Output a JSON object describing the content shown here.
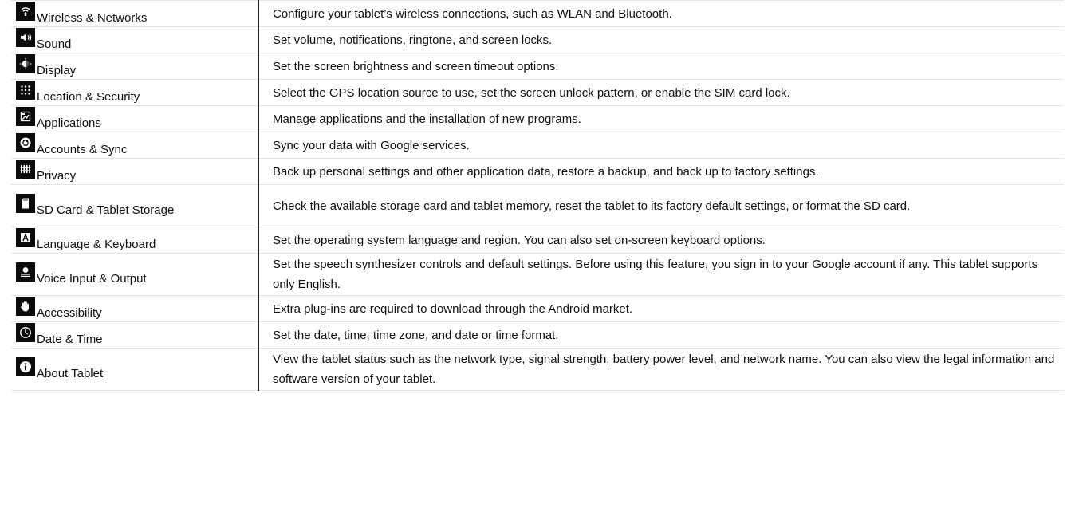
{
  "rows": [
    {
      "icon": "wifi-icon",
      "name": "Wireless & Networks",
      "desc": "Configure your tablet’s wireless connections, such as WLAN and Bluetooth."
    },
    {
      "icon": "speaker-icon",
      "name": "Sound",
      "desc": "Set volume, notifications, ringtone, and screen locks."
    },
    {
      "icon": "brightness-icon",
      "name": "Display",
      "desc": "Set the screen brightness and screen timeout options."
    },
    {
      "icon": "location-grid-icon",
      "name": "Location & Security",
      "desc": "Select the GPS location source to use, set the screen unlock pattern, or enable the SIM card lock."
    },
    {
      "icon": "applications-icon",
      "name": "Applications",
      "desc": "Manage applications and the installation of new programs."
    },
    {
      "icon": "sync-icon",
      "name": "Accounts & Sync",
      "desc": "Sync your data with Google services."
    },
    {
      "icon": "privacy-icon",
      "name": "Privacy",
      "desc": "Back up personal settings and other application data, restore a backup, and back up to factory settings."
    },
    {
      "icon": "sd-card-icon",
      "name": "SD Card & Tablet Storage",
      "desc": "Check the available storage card and tablet memory, reset the tablet to its factory default settings, or format the SD card."
    },
    {
      "icon": "keyboard-letter-icon",
      "name": "Language & Keyboard",
      "desc": "Set the operating system language and region.  You can also set on-screen keyboard options."
    },
    {
      "icon": "voice-icon",
      "name": "Voice Input & Output",
      "desc": "Set the speech synthesizer controls and default settings.  Before using this feature, you sign in to your Google account if any.  This tablet supports only English."
    },
    {
      "icon": "hand-icon",
      "name": "Accessibility",
      "desc": "Extra plug-ins are required to download through the Android market."
    },
    {
      "icon": "clock-icon",
      "name": "Date & Time",
      "desc": "Set the date, time, time zone, and date or time format."
    },
    {
      "icon": "info-icon",
      "name": "About Tablet",
      "desc": "View the tablet status such as the network type, signal strength, battery power level, and network name.  You can also view the legal information and software version of your tablet."
    }
  ]
}
